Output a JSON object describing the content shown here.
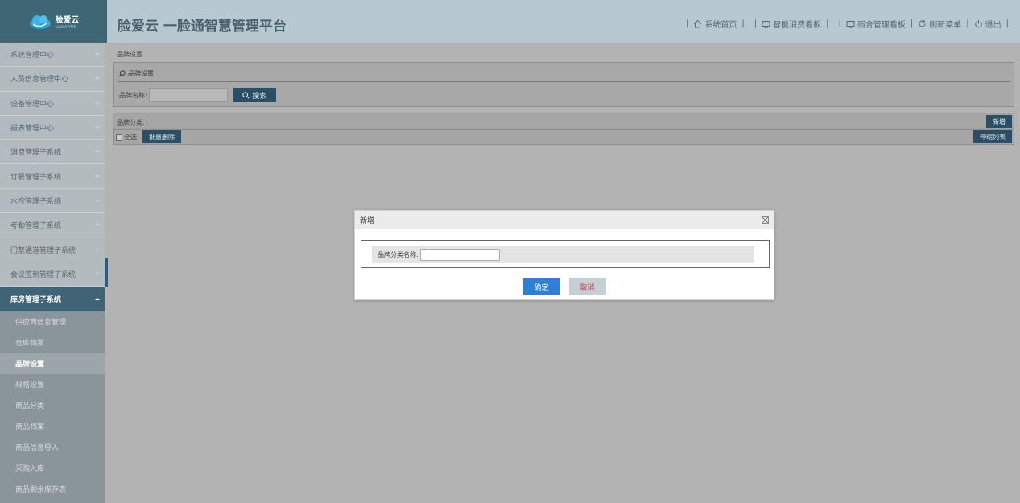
{
  "header": {
    "logo_name": "脸爱云",
    "logo_sub": "LIANAIYUN",
    "title": "脸爱云 一脸通智慧管理平台",
    "nav": [
      {
        "label": "系统首页",
        "icon": "home-icon"
      },
      {
        "label": "智能消费看板",
        "icon": "monitor-icon"
      },
      {
        "label": "宿舍管理看板",
        "icon": "monitor-icon"
      },
      {
        "label": "刷新菜单",
        "icon": "refresh-icon"
      },
      {
        "label": "退出",
        "icon": "power-icon"
      }
    ]
  },
  "sidebar": {
    "menus": [
      "系统管理中心",
      "人员信息管理中心",
      "设备管理中心",
      "报表管理中心",
      "消费管理子系统",
      "订餐管理子系统",
      "水控管理子系统",
      "考勤管理子系统",
      "门禁通道管理子系统",
      "会议签到管理子系统"
    ],
    "open_menu": "库房管理子系统",
    "sub_items": [
      "供应商信息管理",
      "仓库档案",
      "品牌设置",
      "规格设置",
      "商品分类",
      "商品档案",
      "商品信息导入",
      "采购入库",
      "商品剩余库存表"
    ],
    "active_sub": "品牌设置"
  },
  "main": {
    "breadcrumb": "品牌设置",
    "panel_title": "品牌设置",
    "search_label": "品牌名称:",
    "search_value": "",
    "search_button": "搜索",
    "category_label": "品牌分类:",
    "add_button": "新增",
    "select_all": "全选",
    "batch_delete": "批量删除",
    "toggle_list": "伸缩列表"
  },
  "modal": {
    "title": "新增",
    "field_label": "品牌分类名称:",
    "field_value": "",
    "confirm": "确定",
    "cancel": "取消"
  },
  "colors": {
    "header_bg": "#b7c8d0",
    "logo_bg": "#3f6674",
    "primary_button": "#2a4e66",
    "confirm_button": "#2f7fd6",
    "cancel_text": "#d23a3a"
  }
}
